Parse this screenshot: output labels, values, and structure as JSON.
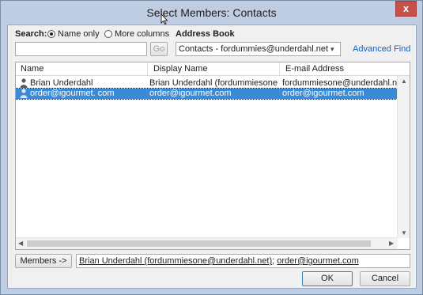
{
  "window": {
    "title": "Select Members: Contacts",
    "close_glyph": "x"
  },
  "search": {
    "label": "Search:",
    "option_name_only": "Name only",
    "option_more_columns": "More columns",
    "input_value": "",
    "go_label": "Go"
  },
  "address_book": {
    "label": "Address Book",
    "selected": "Contacts - fordummies@underdahl.net",
    "advanced_find": "Advanced Find"
  },
  "table": {
    "columns": [
      "Name",
      "Display Name",
      "E-mail Address"
    ],
    "rows": [
      {
        "icon": "contact-person-icon",
        "name": "Brian Underdahl",
        "display_name": "Brian Underdahl (fordummiesone",
        "email": "fordummiesone@underdahl.net",
        "selected": false
      },
      {
        "icon": "contact-person-icon",
        "name": "order@igourmet. com",
        "display_name": "order@igourmet.com",
        "email": "order@igourmet.com",
        "selected": true
      }
    ]
  },
  "members": {
    "button_label": "Members ->",
    "value_part1": "Brian Underdahl (fordummiesone@underdahl.net)",
    "separator": "; ",
    "value_part2": "order@igourmet.com"
  },
  "buttons": {
    "ok": "OK",
    "cancel": "Cancel"
  },
  "colors": {
    "selection": "#3b8ad6",
    "link": "#1a5fb4",
    "close": "#c7504a"
  }
}
